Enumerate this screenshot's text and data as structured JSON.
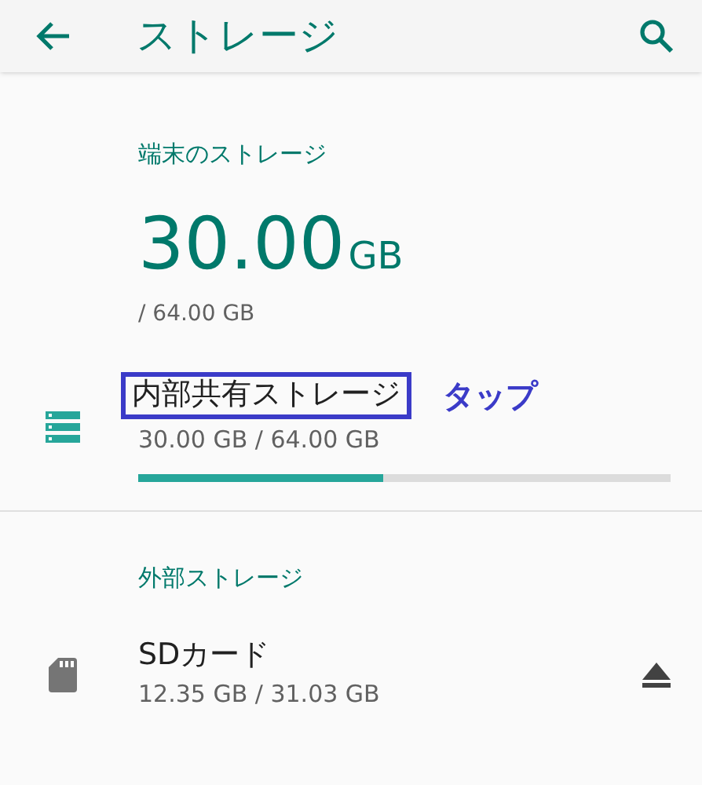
{
  "app_bar": {
    "title": "ストレージ"
  },
  "device_storage": {
    "heading": "端末のストレージ",
    "used": "30.00",
    "unit": "GB",
    "total": "/ 64.00 GB",
    "items": [
      {
        "kind": "internal",
        "name": "内部共有ストレージ",
        "highlighted": true,
        "annotation": "タップ",
        "detail": "30.00 GB / 64.00 GB",
        "level": 0.46
      }
    ]
  },
  "external_storage": {
    "heading": "外部ストレージ",
    "items": [
      {
        "kind": "sd",
        "name": "SDカード",
        "highlighted": false,
        "detail": "12.35 GB / 31.03 GB",
        "ejectable": true
      }
    ]
  }
}
